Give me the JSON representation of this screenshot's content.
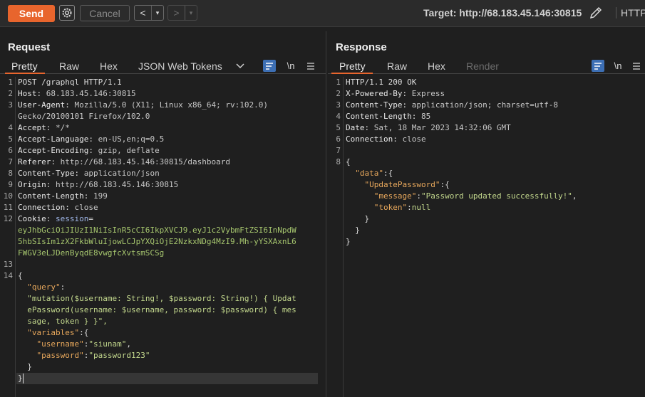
{
  "toolbar": {
    "send_label": "Send",
    "cancel_label": "Cancel",
    "back_label": "<",
    "forward_label": ">",
    "dropdown_label": "▾",
    "target_label": "Target: http://68.183.45.146:30815",
    "http_label": "HTTP/"
  },
  "request": {
    "title": "Request",
    "tabs": [
      {
        "label": "Pretty"
      },
      {
        "label": "Raw"
      },
      {
        "label": "Hex"
      },
      {
        "label": "JSON Web Tokens"
      }
    ],
    "wrap_label": "\\n",
    "headers": [
      {
        "n": "1",
        "text": "POST /graphql HTTP/1.1"
      },
      {
        "n": "2",
        "key": "Host",
        "val": "68.183.45.146:30815"
      },
      {
        "n": "3",
        "key": "User-Agent",
        "val": "Mozilla/5.0 (X11; Linux x86_64; rv:102.0)"
      },
      {
        "n": "",
        "text": "Gecko/20100101 Firefox/102.0"
      },
      {
        "n": "4",
        "key": "Accept",
        "val": "*/*"
      },
      {
        "n": "5",
        "key": "Accept-Language",
        "val": "en-US,en;q=0.5"
      },
      {
        "n": "6",
        "key": "Accept-Encoding",
        "val": "gzip, deflate"
      },
      {
        "n": "7",
        "key": "Referer",
        "val": "http://68.183.45.146:30815/dashboard"
      },
      {
        "n": "8",
        "key": "Content-Type",
        "val": "application/json"
      },
      {
        "n": "9",
        "key": "Origin",
        "val": "http://68.183.45.146:30815"
      },
      {
        "n": "10",
        "key": "Content-Length",
        "val": "199"
      },
      {
        "n": "11",
        "key": "Connection",
        "val": "close"
      },
      {
        "n": "12",
        "key": "Cookie",
        "cookie_name": "session",
        "cookie_lines": [
          "eyJhbGciOiJIUzI1NiIsInR5cCI6IkpXVCJ9.eyJ1c2VybmFtZSI6InNpdW",
          "5hbSIsIm1zX2FkbWluIjowLCJpYXQiOjE2NzkxNDg4MzI9.Mh-yYSXAxnL6",
          "FWGV3eLJDenByqdE8vwgfcXvtsmSCSg"
        ]
      }
    ],
    "body": {
      "query_key": "\"query\"",
      "query_lines": [
        "\"mutation($username: String!, $password: String!) { Updat",
        "ePassword(username: $username, password: $password) { mes",
        "sage, token } }\","
      ],
      "variables_key": "\"variables\"",
      "username_key": "\"username\"",
      "username_val": "\"siunam\"",
      "password_key": "\"password\"",
      "password_val": "\"password123\""
    },
    "line_numbers": [
      "13",
      "14"
    ]
  },
  "response": {
    "title": "Response",
    "tabs": [
      {
        "label": "Pretty"
      },
      {
        "label": "Raw"
      },
      {
        "label": "Hex"
      },
      {
        "label": "Render"
      }
    ],
    "wrap_label": "\\n",
    "status_line": "HTTP/1.1 200 OK",
    "headers": [
      {
        "n": "2",
        "key": "X-Powered-By",
        "val": "Express"
      },
      {
        "n": "3",
        "key": "Content-Type",
        "val": "application/json; charset=utf-8"
      },
      {
        "n": "4",
        "key": "Content-Length",
        "val": "85"
      },
      {
        "n": "5",
        "key": "Date",
        "val": "Sat, 18 Mar 2023 14:32:06 GMT"
      },
      {
        "n": "6",
        "key": "Connection",
        "val": "close"
      }
    ],
    "body": {
      "data_key": "\"data\"",
      "update_key": "\"UpdatePassword\"",
      "message_key": "\"message\"",
      "message_val": "\"Password updated successfully!\"",
      "token_key": "\"token\"",
      "token_val": "null"
    }
  },
  "colors": {
    "accent": "#e8652d",
    "highlight": "#3d6fb4",
    "json_key": "#e8a85c",
    "json_string": "#c3d88d"
  }
}
